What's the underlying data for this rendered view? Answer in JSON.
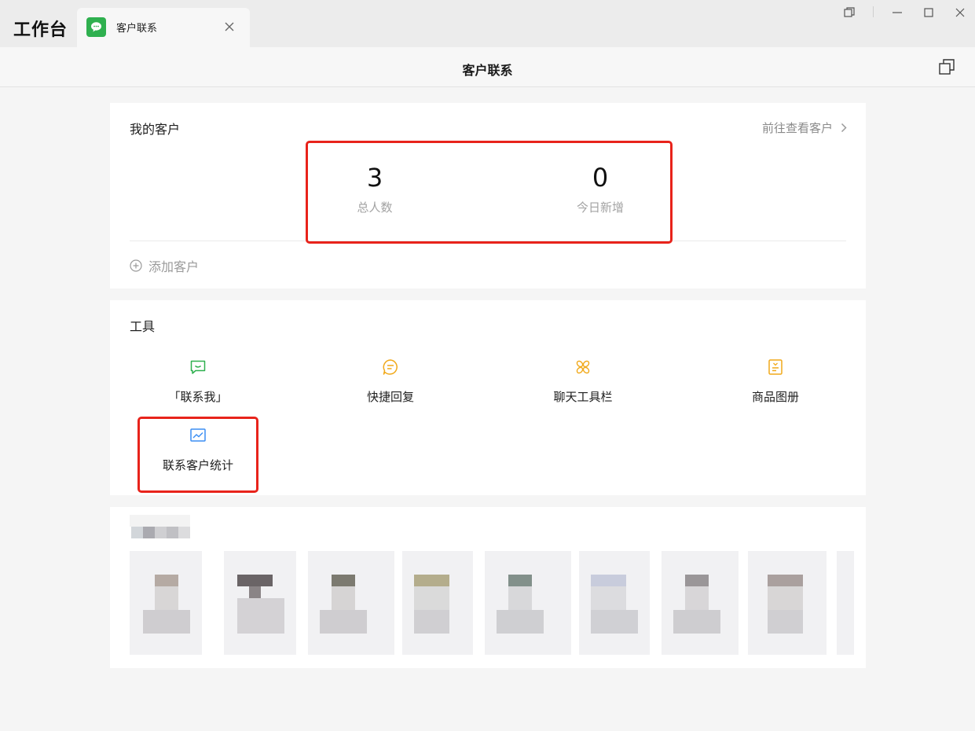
{
  "window": {
    "app_title": "工作台",
    "tab_label": "客户联系",
    "icons": {
      "tab": "wechat-chat-icon",
      "close": "close-icon",
      "restore": "restore-icon",
      "minimize": "minimize-icon",
      "maximize": "maximize-icon",
      "window_close": "window-close-icon"
    }
  },
  "header": {
    "title": "客户联系",
    "popout_icon": "popout-window-icon"
  },
  "customers": {
    "title": "我的客户",
    "view_link": "前往查看客户",
    "stats": [
      {
        "value": "3",
        "label": "总人数"
      },
      {
        "value": "0",
        "label": "今日新增"
      }
    ],
    "add_label": "添加客户"
  },
  "tools": {
    "title": "工具",
    "items": [
      {
        "label": "「联系我」",
        "icon": "chat-smile-icon",
        "color": "#2fb04f"
      },
      {
        "label": "快捷回复",
        "icon": "quick-reply-icon",
        "color": "#f1a91a"
      },
      {
        "label": "聊天工具栏",
        "icon": "toolbar-icon",
        "color": "#f1a91a"
      },
      {
        "label": "商品图册",
        "icon": "catalog-icon",
        "color": "#f1a91a"
      },
      {
        "label": "联系客户统计",
        "icon": "chart-icon",
        "color": "#3b8ef3"
      }
    ]
  },
  "colors": {
    "highlight": "#e8231b",
    "accent_green": "#2fb04f"
  }
}
